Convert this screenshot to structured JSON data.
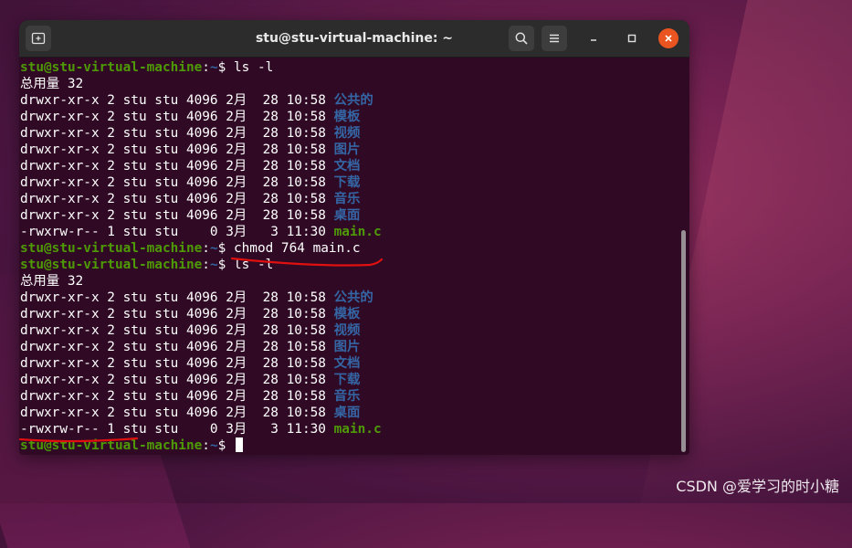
{
  "window": {
    "title": "stu@stu-virtual-machine: ~"
  },
  "colors": {
    "prompt_user": "#4e9a06",
    "prompt_path": "#3465a4",
    "directory": "#3465a4",
    "executable": "#4e9a06",
    "terminal_bg": "#300a24",
    "close_button": "#e95420",
    "annotation": "#e01010"
  },
  "icons": [
    "new-tab-icon",
    "search-icon",
    "hamburger-menu-icon",
    "minimize-icon",
    "maximize-icon",
    "close-icon"
  ],
  "terminal": {
    "prompt_user": "stu@stu-virtual-machine",
    "prompt_colon": ":",
    "prompt_path": "~",
    "prompt_dollar": "$ ",
    "commands": [
      "ls -l",
      "chmod 764 main.c",
      "ls -l",
      ""
    ],
    "total_label": "总用量 32",
    "listing1": [
      {
        "perm": "drwxr-xr-x 2 stu stu 4096 2月  28 10:58 ",
        "name": "公共的",
        "kind": "dir"
      },
      {
        "perm": "drwxr-xr-x 2 stu stu 4096 2月  28 10:58 ",
        "name": "模板",
        "kind": "dir"
      },
      {
        "perm": "drwxr-xr-x 2 stu stu 4096 2月  28 10:58 ",
        "name": "视频",
        "kind": "dir"
      },
      {
        "perm": "drwxr-xr-x 2 stu stu 4096 2月  28 10:58 ",
        "name": "图片",
        "kind": "dir"
      },
      {
        "perm": "drwxr-xr-x 2 stu stu 4096 2月  28 10:58 ",
        "name": "文档",
        "kind": "dir"
      },
      {
        "perm": "drwxr-xr-x 2 stu stu 4096 2月  28 10:58 ",
        "name": "下载",
        "kind": "dir"
      },
      {
        "perm": "drwxr-xr-x 2 stu stu 4096 2月  28 10:58 ",
        "name": "音乐",
        "kind": "dir"
      },
      {
        "perm": "drwxr-xr-x 2 stu stu 4096 2月  28 10:58 ",
        "name": "桌面",
        "kind": "dir"
      },
      {
        "perm": "-rwxrw-r-- 1 stu stu    0 3月   3 11:30 ",
        "name": "main.c",
        "kind": "exe"
      }
    ],
    "listing2": [
      {
        "perm": "drwxr-xr-x 2 stu stu 4096 2月  28 10:58 ",
        "name": "公共的",
        "kind": "dir"
      },
      {
        "perm": "drwxr-xr-x 2 stu stu 4096 2月  28 10:58 ",
        "name": "模板",
        "kind": "dir"
      },
      {
        "perm": "drwxr-xr-x 2 stu stu 4096 2月  28 10:58 ",
        "name": "视频",
        "kind": "dir"
      },
      {
        "perm": "drwxr-xr-x 2 stu stu 4096 2月  28 10:58 ",
        "name": "图片",
        "kind": "dir"
      },
      {
        "perm": "drwxr-xr-x 2 stu stu 4096 2月  28 10:58 ",
        "name": "文档",
        "kind": "dir"
      },
      {
        "perm": "drwxr-xr-x 2 stu stu 4096 2月  28 10:58 ",
        "name": "下载",
        "kind": "dir"
      },
      {
        "perm": "drwxr-xr-x 2 stu stu 4096 2月  28 10:58 ",
        "name": "音乐",
        "kind": "dir"
      },
      {
        "perm": "drwxr-xr-x 2 stu stu 4096 2月  28 10:58 ",
        "name": "桌面",
        "kind": "dir"
      },
      {
        "perm": "-rwxrw-r-- 1 stu stu    0 3月   3 11:30 ",
        "name": "main.c",
        "kind": "exe"
      }
    ]
  },
  "watermark": "CSDN @爱学习的时小糖"
}
